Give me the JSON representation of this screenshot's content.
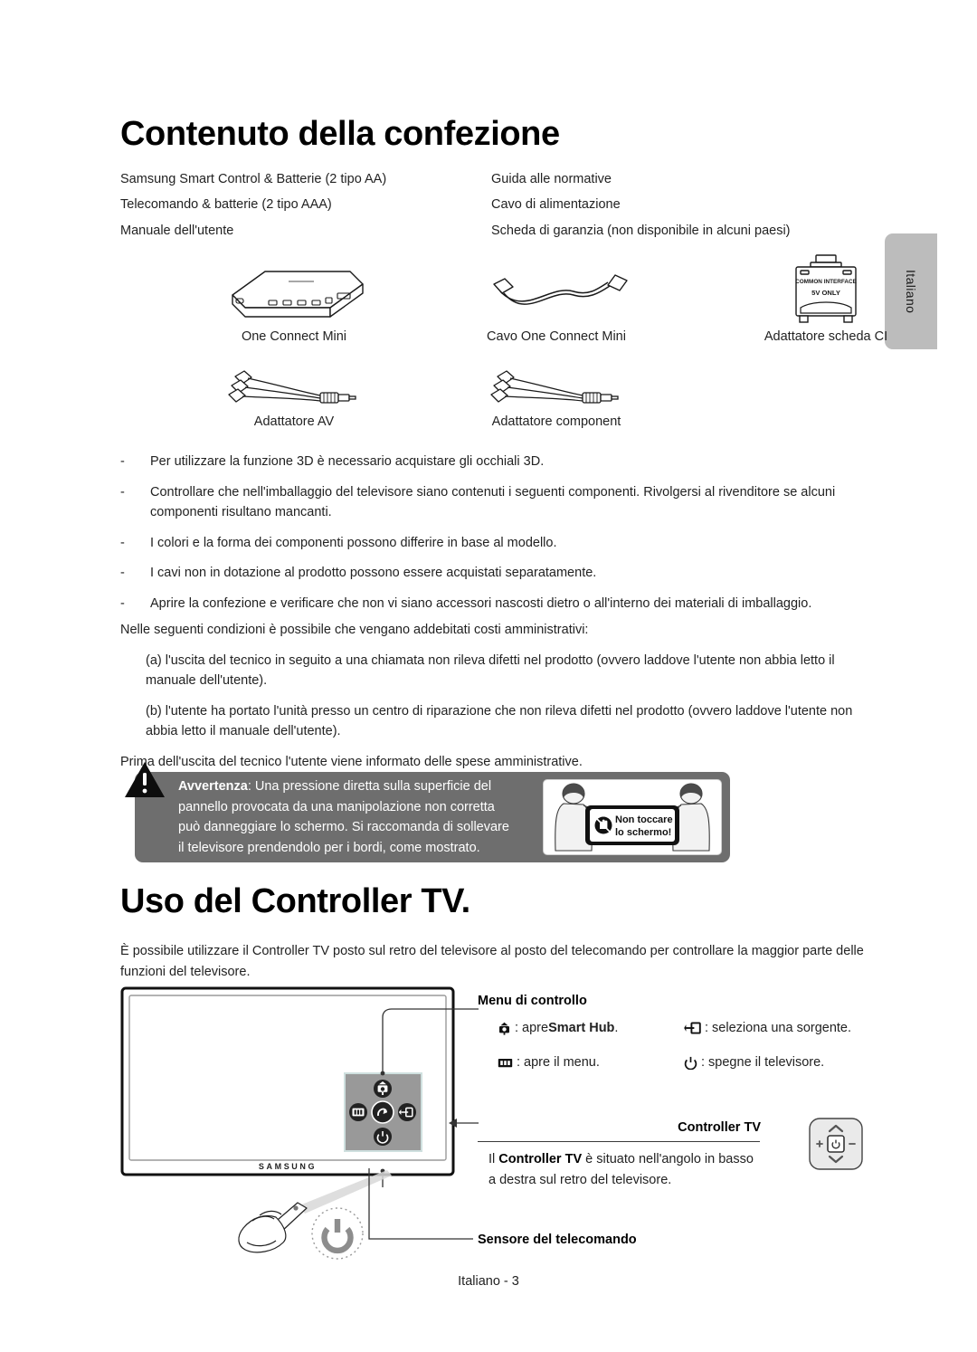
{
  "page": {
    "language_tab": "Italiano",
    "footer": "Italiano - 3"
  },
  "section_contents": {
    "title": "Contenuto della confezione",
    "items_left": [
      "Samsung Smart Control & Batterie (2 tipo AA)",
      "Telecomando & batterie (2 tipo AAA)",
      "Manuale dell'utente"
    ],
    "items_right": [
      "Guida alle normative",
      "Cavo di alimentazione",
      "Scheda di garanzia (non disponibile in alcuni paesi)"
    ],
    "figures": [
      {
        "caption": "One Connect Mini",
        "icon": "one-connect-box-icon"
      },
      {
        "caption": "Cavo One Connect Mini",
        "icon": "one-connect-cable-icon"
      },
      {
        "caption": "Adattatore scheda CI",
        "icon": "ci-card-adapter-icon"
      },
      {
        "caption": "Adattatore AV",
        "icon": "av-adapter-cable-icon"
      },
      {
        "caption": "Adattatore component",
        "icon": "component-adapter-cable-icon"
      }
    ],
    "ci_adapter_labels": {
      "line1": "COMMON INTERFACE",
      "line2": "5V ONLY"
    },
    "dash": "-",
    "notes": [
      "Per utilizzare la funzione 3D è necessario acquistare gli occhiali 3D.",
      "Controllare che nell'imballaggio del televisore siano contenuti i seguenti componenti. Rivolgersi al rivenditore se alcuni componenti risultano mancanti.",
      "I colori e la forma dei componenti possono differire in base al modello.",
      "I cavi non in dotazione al prodotto possono essere acquistati separatamente.",
      "Aprire la confezione e verificare che non vi siano accessori nascosti dietro o all'interno dei materiali di imballaggio."
    ],
    "admin": {
      "intro": "Nelle seguenti condizioni è possibile che vengano addebitati costi amministrativi:",
      "case_a": "(a) l'uscita del tecnico in seguito a una chiamata non rileva difetti nel prodotto (ovvero laddove l'utente non abbia letto il manuale dell'utente).",
      "case_b": "(b) l'utente ha portato l'unità presso un centro di riparazione che non rileva difetti nel prodotto (ovvero laddove l'utente non abbia letto il manuale dell'utente).",
      "closing": "Prima dell'uscita del tecnico l'utente viene informato delle spese amministrative."
    },
    "warning": {
      "label": "Avvertenza",
      "text": ": Una pressione diretta sulla superficie del pannello provocata da una manipolazione non corretta può danneggiare lo schermo. Si raccomanda di sollevare il televisore prendendolo per i bordi, come mostrato.",
      "picture_line1": "Non toccare",
      "picture_line2": "lo schermo!",
      "background_color": "#6e6e6e"
    }
  },
  "section_controller": {
    "title": "Uso del Controller TV.",
    "intro": "È possibile utilizzare il Controller TV posto sul retro del televisore al posto del telecomando per controllare la maggior parte delle funzioni del televisore.",
    "tv_brand": "SAMSUNG",
    "control_menu": {
      "heading": "Menu di controllo",
      "entries": [
        {
          "icon": "smart-hub-icon",
          "text": ": apre ",
          "bold": "Smart Hub",
          "tail": "."
        },
        {
          "icon": "menu-icon",
          "text": ": apre il menu.",
          "bold": "",
          "tail": ""
        },
        {
          "icon": "source-icon",
          "text": ": seleziona una sorgente.",
          "bold": "",
          "tail": ""
        },
        {
          "icon": "power-icon",
          "text": ": spegne il televisore.",
          "bold": "",
          "tail": ""
        }
      ]
    },
    "controller_tv": {
      "heading": "Controller TV",
      "body_pre": "Il ",
      "body_bold": "Controller TV",
      "body_post": " è situato nell'angolo in basso a destra sul retro del televisore."
    },
    "sensor_label": "Sensore del telecomando"
  }
}
